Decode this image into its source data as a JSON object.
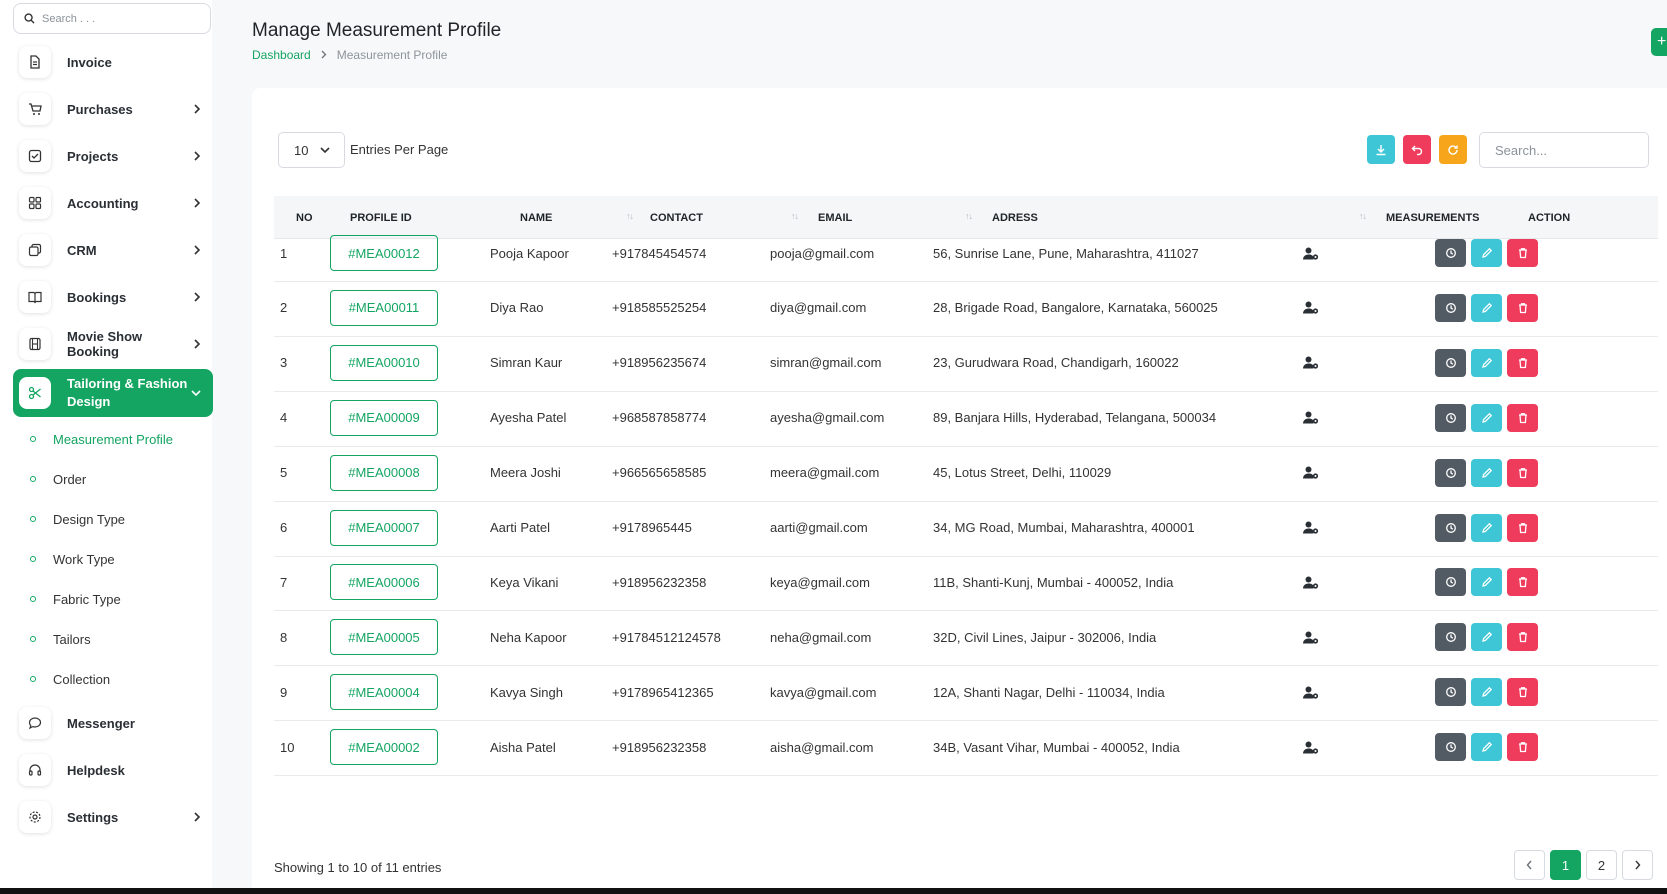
{
  "sidebar": {
    "search_placeholder": "Search . . .",
    "items": [
      {
        "label": "Invoice",
        "icon": "file-icon",
        "has_chevron": false
      },
      {
        "label": "Purchases",
        "icon": "cart-icon",
        "has_chevron": true
      },
      {
        "label": "Projects",
        "icon": "checkbox-icon",
        "has_chevron": true
      },
      {
        "label": "Accounting",
        "icon": "grid-icon",
        "has_chevron": true
      },
      {
        "label": "CRM",
        "icon": "layers-icon",
        "has_chevron": true
      },
      {
        "label": "Bookings",
        "icon": "book-icon",
        "has_chevron": true
      },
      {
        "label": "Movie Show Booking",
        "icon": "film-icon",
        "has_chevron": true
      },
      {
        "label": "Tailoring & Fashion Design",
        "icon": "scissors-icon",
        "has_chevron": true,
        "active": true
      },
      {
        "label": "Messenger",
        "icon": "chat-icon",
        "has_chevron": false
      },
      {
        "label": "Helpdesk",
        "icon": "headphones-icon",
        "has_chevron": false
      },
      {
        "label": "Settings",
        "icon": "gear-icon",
        "has_chevron": true
      }
    ],
    "subitems": [
      {
        "label": "Measurement Profile",
        "active": true
      },
      {
        "label": "Order"
      },
      {
        "label": "Design Type"
      },
      {
        "label": "Work Type"
      },
      {
        "label": "Fabric Type"
      },
      {
        "label": "Tailors"
      },
      {
        "label": "Collection"
      }
    ]
  },
  "header": {
    "title": "Manage Measurement Profile",
    "breadcrumb_home": "Dashboard",
    "breadcrumb_current": "Measurement Profile",
    "add_label": "+"
  },
  "toolbar": {
    "entries_value": "10",
    "entries_label": "Entries Per Page",
    "search_placeholder": "Search...",
    "colors": {
      "download": "#3ec6d6",
      "undo": "#ef3b5c",
      "refresh": "#f7a51b"
    }
  },
  "table": {
    "columns": [
      "NO",
      "PROFILE ID",
      "NAME",
      "CONTACT",
      "EMAIL",
      "ADRESS",
      "MEASUREMENTS",
      "ACTION"
    ],
    "rows": [
      {
        "no": "1",
        "id": "#MEA00012",
        "name": "Pooja Kapoor",
        "contact": "+917845454574",
        "email": "pooja@gmail.com",
        "address": "56, Sunrise Lane, Pune, Maharashtra, 411027"
      },
      {
        "no": "2",
        "id": "#MEA00011",
        "name": "Diya Rao",
        "contact": "+918585525254",
        "email": "diya@gmail.com",
        "address": "28, Brigade Road, Bangalore, Karnataka, 560025"
      },
      {
        "no": "3",
        "id": "#MEA00010",
        "name": "Simran Kaur",
        "contact": "+918956235674",
        "email": "simran@gmail.com",
        "address": "23, Gurudwara Road, Chandigarh, 160022"
      },
      {
        "no": "4",
        "id": "#MEA00009",
        "name": "Ayesha Patel",
        "contact": "+968587858774",
        "email": "ayesha@gmail.com",
        "address": "89, Banjara Hills, Hyderabad, Telangana, 500034"
      },
      {
        "no": "5",
        "id": "#MEA00008",
        "name": "Meera Joshi",
        "contact": "+966565658585",
        "email": "meera@gmail.com",
        "address": "45, Lotus Street, Delhi, 110029"
      },
      {
        "no": "6",
        "id": "#MEA00007",
        "name": "Aarti Patel",
        "contact": "+9178965445",
        "email": "aarti@gmail.com",
        "address": "34, MG Road, Mumbai, Maharashtra, 400001"
      },
      {
        "no": "7",
        "id": "#MEA00006",
        "name": "Keya Vikani",
        "contact": "+918956232358",
        "email": "keya@gmail.com",
        "address": "11B, Shanti-Kunj, Mumbai - 400052, India"
      },
      {
        "no": "8",
        "id": "#MEA00005",
        "name": "Neha Kapoor",
        "contact": "+91784512124578",
        "email": "neha@gmail.com",
        "address": "32D, Civil Lines, Jaipur - 302006, India"
      },
      {
        "no": "9",
        "id": "#MEA00004",
        "name": "Kavya Singh",
        "contact": "+9178965412365",
        "email": "kavya@gmail.com",
        "address": "12A, Shanti Nagar, Delhi - 110034, India"
      },
      {
        "no": "10",
        "id": "#MEA00002",
        "name": "Aisha Patel",
        "contact": "+918956232358",
        "email": "aisha@gmail.com",
        "address": "34B, Vasant Vihar, Mumbai - 400052, India"
      }
    ]
  },
  "footer": {
    "showing": "Showing 1 to 10 of 11 entries",
    "pages": [
      "1",
      "2"
    ],
    "current_page": "1"
  },
  "colors": {
    "accent": "#14a562"
  }
}
